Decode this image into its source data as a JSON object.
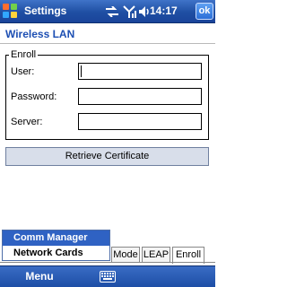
{
  "titlebar": {
    "title": "Settings",
    "time": "14:17",
    "ok_label": "ok",
    "icons": [
      "windows-start-icon",
      "connectivity-icon",
      "signal-icon",
      "speaker-icon"
    ]
  },
  "page": {
    "title": "Wireless LAN"
  },
  "enroll": {
    "legend": "Enroll",
    "user_label": "User:",
    "user_value": "",
    "password_label": "Password:",
    "password_value": "",
    "server_label": "Server:",
    "server_value": ""
  },
  "retrieve_button": "Retrieve Certificate",
  "tabs": [
    "Mode",
    "LEAP",
    "Enroll"
  ],
  "active_tab": "Enroll",
  "popup_menu": {
    "items": [
      "Comm Manager",
      "Network Cards"
    ],
    "highlighted": "Comm Manager"
  },
  "softbar": {
    "menu_label": "Menu",
    "keyboard_icon": "keyboard-icon"
  },
  "colors": {
    "titlebar": "#1f4fa3",
    "accent_text": "#1d4fb3",
    "menu_highlight": "#2f62c3"
  }
}
